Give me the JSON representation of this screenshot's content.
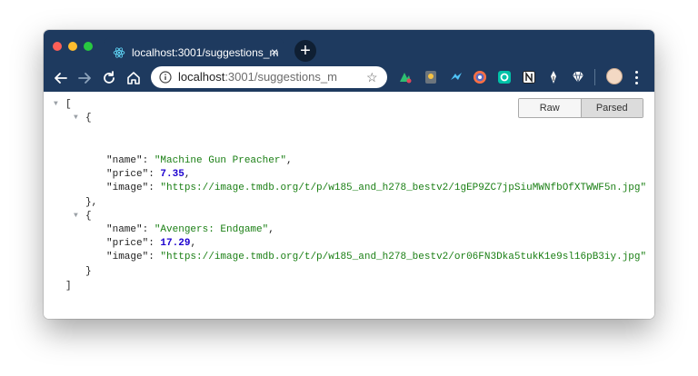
{
  "tab": {
    "title": "localhost:3001/suggestions_m",
    "close": "×",
    "new_tab": "+"
  },
  "omnibox": {
    "host": "localhost",
    "path": ":3001/suggestions_m"
  },
  "toolbar": {
    "back": "back-icon",
    "forward": "forward-icon",
    "reload": "reload-icon",
    "home": "home-icon"
  },
  "extensions": [
    "extension-icon-1",
    "extension-icon-2",
    "extension-icon-3",
    "extension-icon-4",
    "extension-icon-5",
    "extension-icon-6",
    "extension-icon-7",
    "extension-icon-8"
  ],
  "viewer": {
    "raw_label": "Raw",
    "parsed_label": "Parsed",
    "selected": "Parsed"
  },
  "json": {
    "open_bracket": "[",
    "close_bracket": "]",
    "open_brace": "{",
    "close_brace": "}",
    "close_brace_comma": "},",
    "items": [
      {
        "name_key": "\"name\"",
        "name_value": "\"Machine Gun Preacher\"",
        "price_key": "\"price\"",
        "price_value": "7.35",
        "image_key": "\"image\"",
        "image_value": "\"https://image.tmdb.org/t/p/w185_and_h278_bestv2/1gEP9ZC7jpSiuMWNfbOfXTWWF5n.jpg\""
      },
      {
        "name_key": "\"name\"",
        "name_value": "\"Avengers: Endgame\"",
        "price_key": "\"price\"",
        "price_value": "17.29",
        "image_key": "\"image\"",
        "image_value": "\"https://image.tmdb.org/t/p/w185_and_h278_bestv2/or06FN3Dka5tukK1e9sl16pB3iy.jpg\""
      }
    ]
  }
}
